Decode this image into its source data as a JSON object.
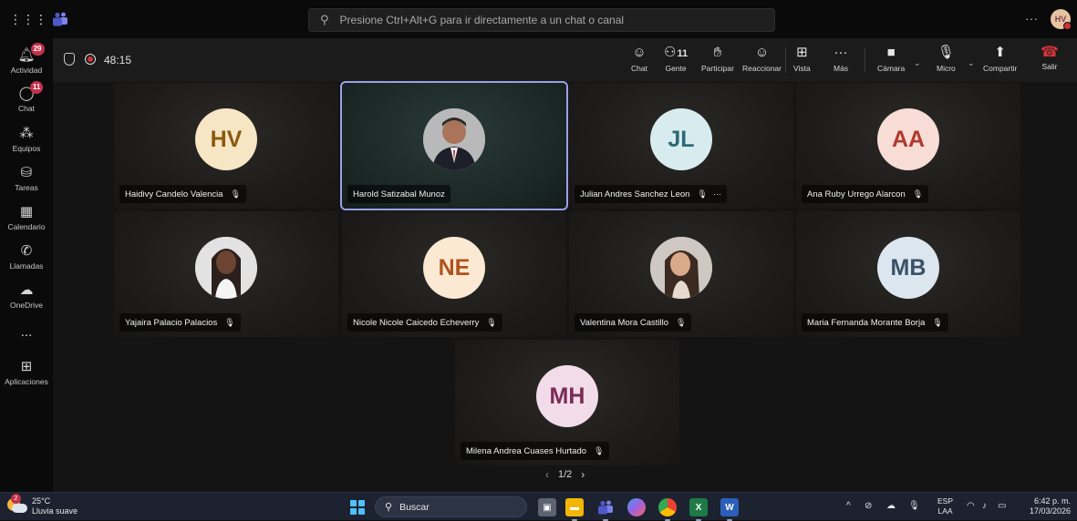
{
  "titlebar": {
    "search_placeholder": "Presione Ctrl+Alt+G para ir directamente a un chat o canal",
    "user_initials": "HV"
  },
  "rail": {
    "items": [
      {
        "label": "Actividad",
        "icon": "bell-icon",
        "badge": "29"
      },
      {
        "label": "Chat",
        "icon": "chat-icon",
        "badge": "11"
      },
      {
        "label": "Equipos",
        "icon": "teams-icon",
        "badge": ""
      },
      {
        "label": "Tareas",
        "icon": "tasks-icon",
        "badge": ""
      },
      {
        "label": "Calendario",
        "icon": "calendar-icon",
        "badge": ""
      },
      {
        "label": "Llamadas",
        "icon": "phone-icon",
        "badge": ""
      },
      {
        "label": "OneDrive",
        "icon": "cloud-icon",
        "badge": ""
      },
      {
        "label": "...",
        "icon": "more-icon",
        "badge": ""
      },
      {
        "label": "Aplicaciones",
        "icon": "apps-icon",
        "badge": ""
      }
    ]
  },
  "meeting": {
    "timer": "48:15",
    "people_count": "11",
    "tools": {
      "chat": "Chat",
      "people": "Gente",
      "raise": "Participar",
      "react": "Reaccionar",
      "view": "Vista",
      "more": "Más",
      "camera": "Cámara",
      "mic": "Micro",
      "share": "Compartir",
      "leave": "Salir"
    }
  },
  "participants": [
    {
      "name": "Haidivy Candelo Valencia",
      "initials": "HV",
      "avatar_bg": "#f6e6c4",
      "avatar_fg": "#8a5a10",
      "photo": false,
      "muted": true,
      "more": false,
      "active": false
    },
    {
      "name": "Harold Satizabal Munoz",
      "initials": "",
      "avatar_bg": "#c8c8c8",
      "avatar_fg": "#333333",
      "photo": true,
      "muted": false,
      "more": false,
      "active": true
    },
    {
      "name": "Julian Andres Sanchez Leon",
      "initials": "JL",
      "avatar_bg": "#d8ecf0",
      "avatar_fg": "#2d6a75",
      "photo": false,
      "muted": true,
      "more": true,
      "active": false
    },
    {
      "name": "Ana Ruby Urrego Alarcon",
      "initials": "AA",
      "avatar_bg": "#f8dcd6",
      "avatar_fg": "#b03a2e",
      "photo": false,
      "muted": true,
      "more": false,
      "active": false
    },
    {
      "name": "Yajaira Palacio Palacios",
      "initials": "",
      "avatar_bg": "#dcdcdc",
      "avatar_fg": "#333333",
      "photo": true,
      "muted": true,
      "more": false,
      "active": false
    },
    {
      "name": "Nicole Nicole Caicedo Echeverry",
      "initials": "NE",
      "avatar_bg": "#fbe9d4",
      "avatar_fg": "#b0531a",
      "photo": false,
      "muted": true,
      "more": false,
      "active": false
    },
    {
      "name": "Valentina Mora Castillo",
      "initials": "",
      "avatar_bg": "#d9d2cc",
      "avatar_fg": "#333333",
      "photo": true,
      "muted": true,
      "more": false,
      "active": false
    },
    {
      "name": "Maria Fernanda Morante Borja",
      "initials": "MB",
      "avatar_bg": "#dce6ee",
      "avatar_fg": "#3b5167",
      "photo": false,
      "muted": true,
      "more": false,
      "active": false
    },
    {
      "name": "Milena Andrea Cuases Hurtado",
      "initials": "MH",
      "avatar_bg": "#f3dcea",
      "avatar_fg": "#7a2c55",
      "photo": false,
      "muted": true,
      "more": false,
      "active": false
    }
  ],
  "pager": {
    "label": "1/2"
  },
  "taskbar": {
    "weather_temp": "25°C",
    "weather_desc": "Lluvia suave",
    "weather_badge": "2",
    "search_label": "Buscar",
    "lang_top": "ESP",
    "lang_bottom": "LAA",
    "time": "6:42 p. m.",
    "date": "17/03/2026"
  }
}
